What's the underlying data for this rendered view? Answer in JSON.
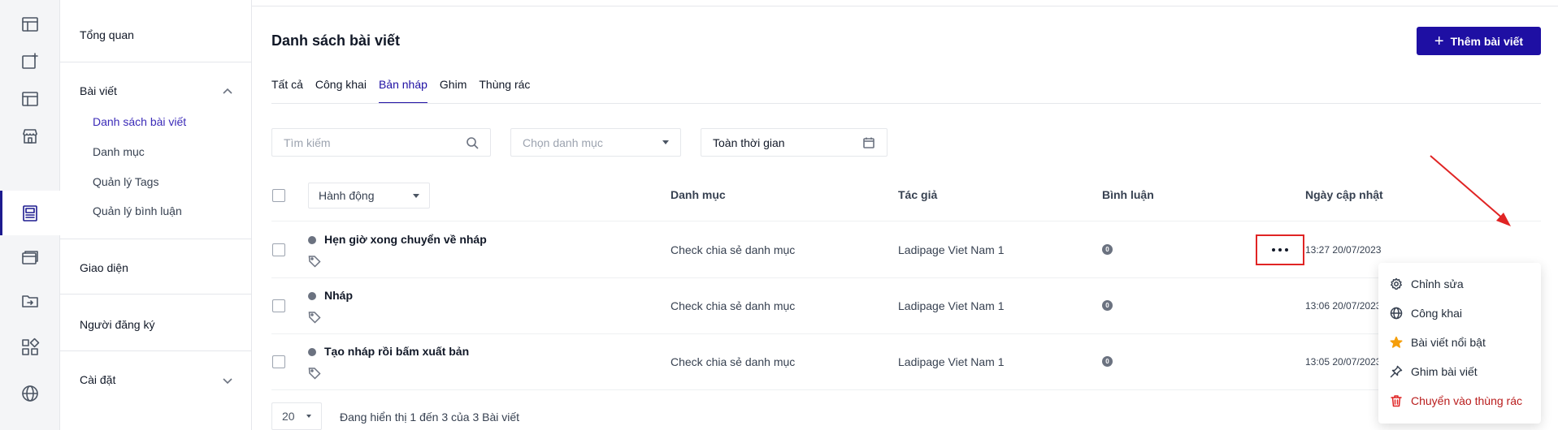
{
  "sidebar_sections": {
    "overview": "Tổng quan",
    "posts": "Bài viết",
    "post_children": [
      "Danh sách bài viết",
      "Danh mục",
      "Quản lý Tags",
      "Quản lý bình luận"
    ],
    "appearance": "Giao diện",
    "subscribers": "Người đăng ký",
    "settings": "Cài đặt"
  },
  "header": {
    "title": "Danh sách bài viết",
    "add_button": "Thêm bài viết"
  },
  "tabs": [
    "Tất cả",
    "Công khai",
    "Bản nháp",
    "Ghim",
    "Thùng rác"
  ],
  "active_tab": "Bản nháp",
  "filters": {
    "search_placeholder": "Tìm kiếm",
    "category_placeholder": "Chọn danh mục",
    "time_value": "Toàn thời gian"
  },
  "table": {
    "action_select": "Hành động",
    "columns": {
      "category": "Danh mục",
      "author": "Tác giả",
      "comments": "Bình luận",
      "updated": "Ngày cập nhật"
    },
    "rows": [
      {
        "title": "Hẹn giờ xong chuyển về nháp",
        "category": "Check chia sẻ danh mục",
        "author": "Ladipage Viet Nam 1",
        "comments": "0",
        "updated": "13:27 20/07/2023"
      },
      {
        "title": "Nháp",
        "category": "Check chia sẻ danh mục",
        "author": "Ladipage Viet Nam 1",
        "comments": "0",
        "updated": "13:06 20/07/2023"
      },
      {
        "title": "Tạo nháp rồi bấm xuất bản",
        "category": "Check chia sẻ danh mục",
        "author": "Ladipage Viet Nam 1",
        "comments": "0",
        "updated": "13:05 20/07/2023"
      }
    ]
  },
  "context_menu": {
    "edit": "Chỉnh sửa",
    "publish": "Công khai",
    "feature": "Bài viết nổi bật",
    "pin": "Ghim bài viết",
    "trash": "Chuyển vào thùng rác"
  },
  "pagination": {
    "page_size": "20",
    "showing": "Đang hiển thị 1 đến 3 của 3 Bài viết"
  },
  "colors": {
    "primary": "#1e0fa3",
    "annotation": "#e02424",
    "star": "#f59e0b"
  }
}
